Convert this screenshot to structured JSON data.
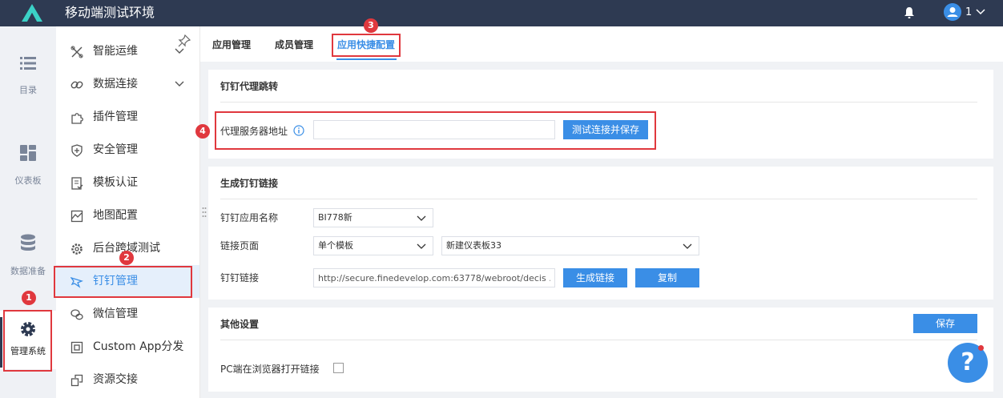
{
  "header": {
    "app_title": "移动端测试环境",
    "user_name": "1"
  },
  "rail": {
    "items": [
      {
        "label": "目录"
      },
      {
        "label": "仪表板"
      },
      {
        "label": "数据准备"
      },
      {
        "label": "管理系统"
      }
    ]
  },
  "sidebar": {
    "items": [
      {
        "label": "智能运维"
      },
      {
        "label": "数据连接"
      },
      {
        "label": "插件管理"
      },
      {
        "label": "安全管理"
      },
      {
        "label": "模板认证"
      },
      {
        "label": "地图配置"
      },
      {
        "label": "后台跨域测试"
      },
      {
        "label": "钉钉管理"
      },
      {
        "label": "微信管理"
      },
      {
        "label": "Custom App分发"
      },
      {
        "label": "资源交接"
      }
    ],
    "active_index": 7
  },
  "tabs": [
    {
      "label": "应用管理"
    },
    {
      "label": "成员管理"
    },
    {
      "label": "应用快捷配置"
    }
  ],
  "proxy_section": {
    "title": "钉钉代理跳转",
    "address_label": "代理服务器地址",
    "address_value": "",
    "test_save_button": "测试连接并保存"
  },
  "link_section": {
    "title": "生成钉钉链接",
    "app_name_label": "钉钉应用名称",
    "app_name_value": "BI778新",
    "link_page_label": "链接页面",
    "link_page_type": "单个模板",
    "link_page_target": "新建仪表板33",
    "link_label": "钉钉链接",
    "link_value": "http://secure.finedevelop.com:63778/webroot/decis ...",
    "generate_button": "生成链接",
    "copy_button": "复制"
  },
  "other_section": {
    "title": "其他设置",
    "save_button": "保存",
    "pc_browser_label": "PC端在浏览器打开链接",
    "pc_browser_checked": false
  },
  "annotations": {
    "steps": [
      "1",
      "2",
      "3",
      "4"
    ]
  },
  "help": {
    "label": "?"
  },
  "colors": {
    "header_bg": "#2e3a52",
    "accent": "#3a8ee6",
    "annotation_red": "#e0383e",
    "active_bg": "#e5effb"
  }
}
